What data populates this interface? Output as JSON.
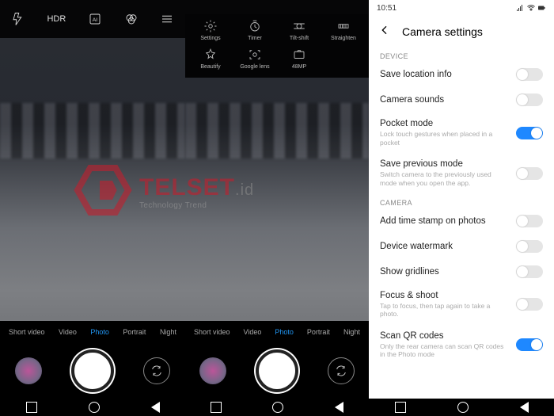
{
  "watermark": {
    "name": "TELSET",
    "suffix": ".id",
    "sub": "Technology Trend"
  },
  "panel1": {
    "topbar": [
      "flash",
      "HDR",
      "AI",
      "filter",
      "menu"
    ],
    "hdr_label": "HDR",
    "modes": [
      "Short video",
      "Video",
      "Photo",
      "Portrait",
      "Night"
    ],
    "active_mode": "Photo"
  },
  "panel2": {
    "options": [
      {
        "label": "Settings"
      },
      {
        "label": "Timer"
      },
      {
        "label": "Tilt-shift"
      },
      {
        "label": "Straighten"
      },
      {
        "label": "Beautify"
      },
      {
        "label": "Google lens"
      },
      {
        "label": "48MP"
      }
    ],
    "modes": [
      "Short video",
      "Video",
      "Photo",
      "Portrait",
      "Night"
    ],
    "active_mode": "Photo"
  },
  "settings": {
    "status_time": "10:51",
    "title": "Camera settings",
    "sections": {
      "device": "DEVICE",
      "camera": "CAMERA"
    },
    "rows": {
      "loc": {
        "title": "Save location info",
        "sub": "",
        "on": false
      },
      "snd": {
        "title": "Camera sounds",
        "sub": "",
        "on": false
      },
      "pocket": {
        "title": "Pocket mode",
        "sub": "Lock touch gestures when placed in a pocket",
        "on": true
      },
      "prev": {
        "title": "Save previous mode",
        "sub": "Switch camera to the previously used mode when you open the app.",
        "on": false
      },
      "stamp": {
        "title": "Add time stamp on photos",
        "sub": "",
        "on": false
      },
      "wm": {
        "title": "Device watermark",
        "sub": "",
        "on": false
      },
      "grid": {
        "title": "Show gridlines",
        "sub": "",
        "on": false
      },
      "focus": {
        "title": "Focus & shoot",
        "sub": "Tap to focus, then tap again to take a photo.",
        "on": false
      },
      "qr": {
        "title": "Scan QR codes",
        "sub": "Only the rear camera can scan QR codes in the Photo mode",
        "on": true
      }
    }
  }
}
